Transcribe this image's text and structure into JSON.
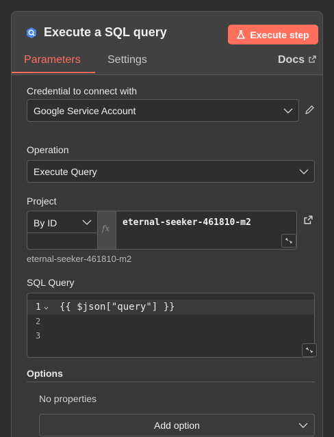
{
  "header": {
    "title": "Execute a SQL query",
    "execute_label": "Execute step"
  },
  "tabs": {
    "parameters": "Parameters",
    "settings": "Settings",
    "docs": "Docs"
  },
  "credential": {
    "label": "Credential to connect with",
    "value": "Google Service Account"
  },
  "operation": {
    "label": "Operation",
    "value": "Execute Query"
  },
  "project": {
    "label": "Project",
    "mode": "By ID",
    "fx": "fx",
    "value": "eternal-seeker-461810-m2",
    "resolved": "eternal-seeker-461810-m2"
  },
  "sql": {
    "label": "SQL Query",
    "lines": [
      {
        "num": "1",
        "text": "{{ $json[\"query\"] }}"
      },
      {
        "num": "2",
        "text": ""
      },
      {
        "num": "3",
        "text": ""
      }
    ]
  },
  "options": {
    "label": "Options",
    "empty_text": "No properties",
    "add_label": "Add option"
  },
  "colors": {
    "accent": "#ff6f5c",
    "panel": "#414141",
    "body": "#383838"
  }
}
